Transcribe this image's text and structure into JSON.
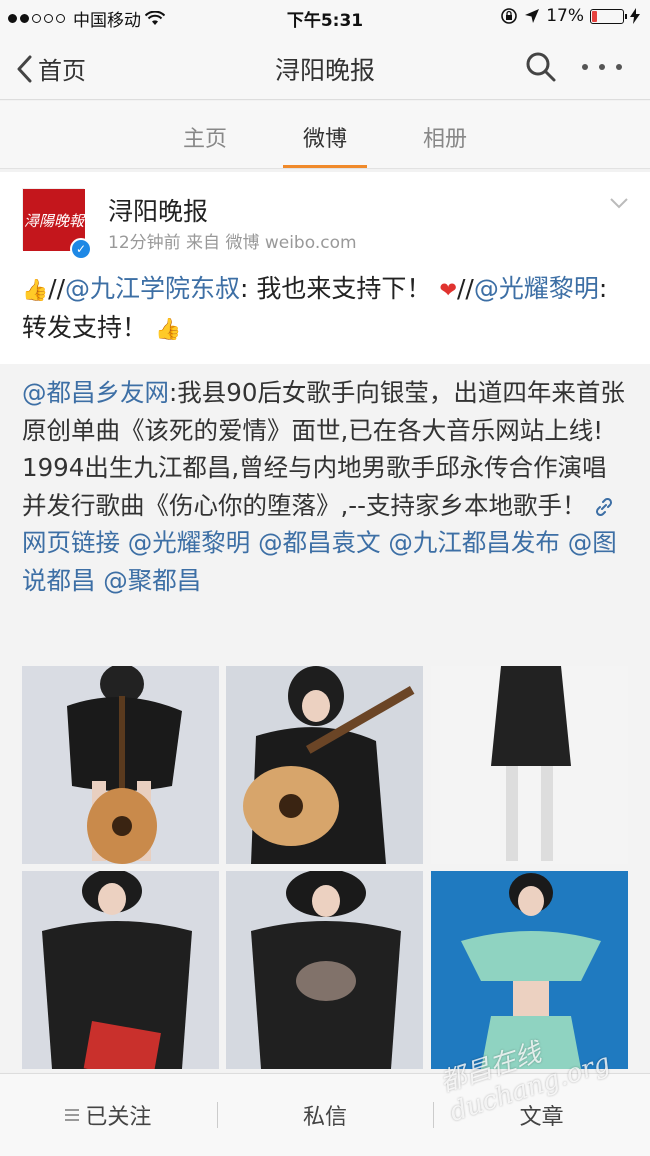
{
  "status_bar": {
    "carrier": "中国移动",
    "time": "下午5:31",
    "battery": "17%",
    "battery_level": 0.17,
    "signal_dots_filled": 2,
    "signal_dots_total": 5
  },
  "nav": {
    "back_label": "首页",
    "title": "浔阳晚报"
  },
  "tabs": [
    {
      "label": "主页",
      "active": false
    },
    {
      "label": "微博",
      "active": true
    },
    {
      "label": "相册",
      "active": false
    }
  ],
  "post": {
    "avatar_text": "潯陽晚報",
    "author": "浔阳晚报",
    "meta": "12分钟前  来自 微博 weibo.com",
    "repost_segments": {
      "prefix": "//",
      "mention1": "@九江学院东叔",
      "text1": ": 我也来支持下！",
      "prefix2": "//",
      "mention2": "@光耀黎明",
      "text2": ":转发支持！"
    },
    "quoted": {
      "mention_source": "@都昌乡友网",
      "body": ":我县90后女歌手向银莹，出道四年来首张原创单曲《该死的爱情》面世,已在各大音乐网站上线! 1994出生九江都昌,曾经与内地男歌手邱永传合作演唱并发行歌曲《伤心你的堕落》,--支持家乡本地歌手！",
      "link_label": "网页链接",
      "mentions": [
        "@光耀黎明",
        "@都昌袁文",
        "@九江都昌发布",
        "@图说都昌",
        "@聚都昌"
      ]
    }
  },
  "bottom_bar": {
    "follow_label": "已关注",
    "message_label": "私信",
    "articles_label": "文章"
  },
  "watermark": "都昌在线 duchang.org",
  "colors": {
    "accent_orange": "#f08a2b",
    "link_blue": "#3d6fa5",
    "brand_red": "#c4161c",
    "verified_blue": "#1e88e5"
  }
}
